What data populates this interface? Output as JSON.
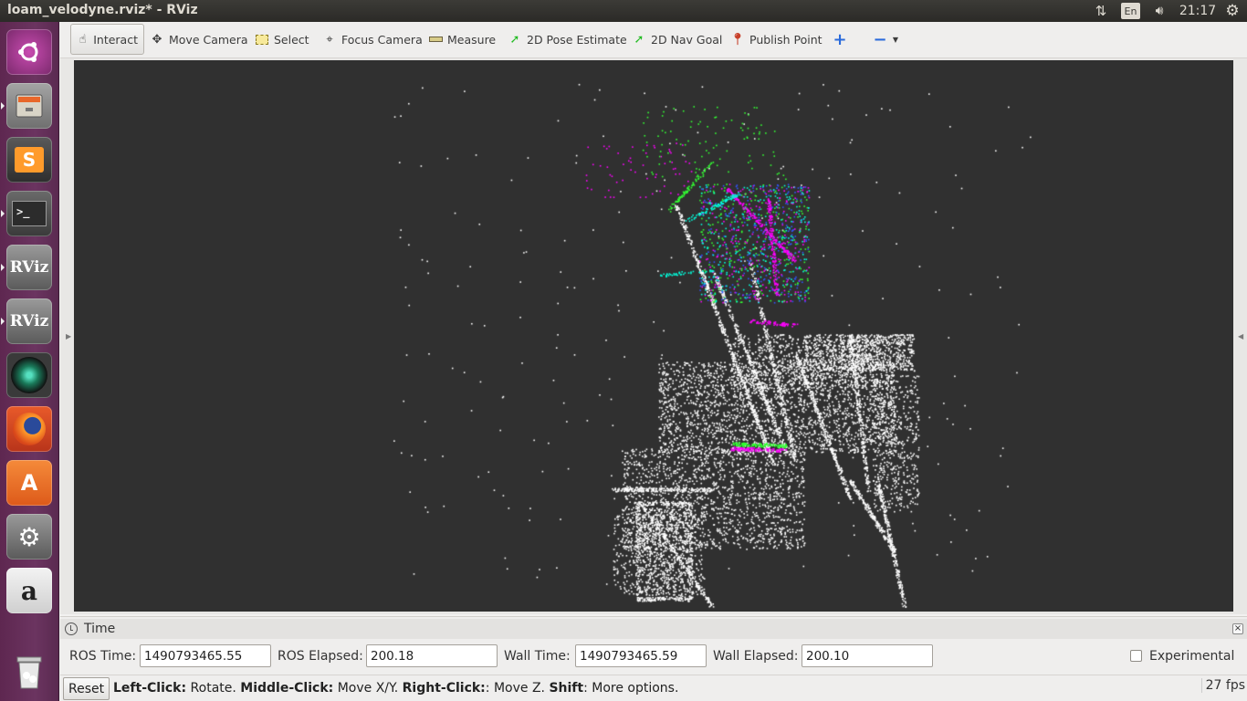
{
  "window_title": "loam_velodyne.rviz* - RViz",
  "top_panel": {
    "keyboard_layout": "En",
    "clock": "21:17",
    "icons": [
      "network-icon",
      "keyboard-icon",
      "sound-icon",
      "settings-gear-icon"
    ]
  },
  "launcher": {
    "items": [
      {
        "name": "ubuntu-dash",
        "icon": "ubuntu-logo-icon"
      },
      {
        "name": "files",
        "icon": "file-cabinet-icon"
      },
      {
        "name": "sublime-text",
        "icon": "sublime-text-icon",
        "glyph": "S"
      },
      {
        "name": "terminal",
        "icon": "terminal-icon",
        "glyph": ">_"
      },
      {
        "name": "rviz-1",
        "icon": "rviz-icon",
        "glyph": "RViz"
      },
      {
        "name": "rviz-2",
        "icon": "rviz-icon",
        "glyph": "RViz"
      },
      {
        "name": "webcam",
        "icon": "camera-lens-icon"
      },
      {
        "name": "firefox",
        "icon": "firefox-icon"
      },
      {
        "name": "software-center",
        "icon": "software-center-icon",
        "glyph": "A"
      },
      {
        "name": "system-settings",
        "icon": "wrench-gear-icon"
      },
      {
        "name": "amazon",
        "icon": "amazon-icon",
        "glyph": "a"
      },
      {
        "name": "trash",
        "icon": "trash-icon"
      }
    ]
  },
  "toolbar": {
    "tools": [
      {
        "label": "Interact",
        "icon": "hand-pointer-icon",
        "active": true
      },
      {
        "label": "Move Camera",
        "icon": "move-camera-icon"
      },
      {
        "label": "Select",
        "icon": "select-rectangle-icon"
      },
      {
        "label": "Focus Camera",
        "icon": "focus-camera-icon"
      },
      {
        "label": "Measure",
        "icon": "ruler-icon"
      },
      {
        "label": "2D Pose Estimate",
        "icon": "green-arrow-icon"
      },
      {
        "label": "2D Nav Goal",
        "icon": "green-arrow-icon"
      },
      {
        "label": "Publish Point",
        "icon": "map-pin-icon"
      }
    ],
    "add_tool_icon": "plus-icon",
    "remove_tool_icon": "minus-icon"
  },
  "time_panel": {
    "title": "Time",
    "ros_time_label": "ROS Time:",
    "ros_time": "1490793465.55",
    "ros_elapsed_label": "ROS Elapsed:",
    "ros_elapsed": "200.18",
    "wall_time_label": "Wall Time:",
    "wall_time": "1490793465.59",
    "wall_elapsed_label": "Wall Elapsed:",
    "wall_elapsed": "200.10",
    "experimental_label": "Experimental",
    "experimental_checked": false
  },
  "status_bar": {
    "reset_label": "Reset",
    "left_click": "Left-Click:",
    "rotate": " Rotate. ",
    "middle_click": "Middle-Click:",
    "move_xy": " Move X/Y. ",
    "right_click": "Right-Click:",
    "move_z": ": Move Z. ",
    "shift": "Shift",
    "more_options": ": More options.",
    "fps": "27 fps"
  },
  "colors": {
    "render_background": "#303030",
    "launcher_purple": "#5e2750",
    "top_panel": "#3c3b37",
    "point_white": "#ffffff",
    "point_magenta": "#ff00ff",
    "point_green": "#33ff33",
    "point_blue": "#3355ff",
    "point_cyan": "#00ffdd"
  }
}
